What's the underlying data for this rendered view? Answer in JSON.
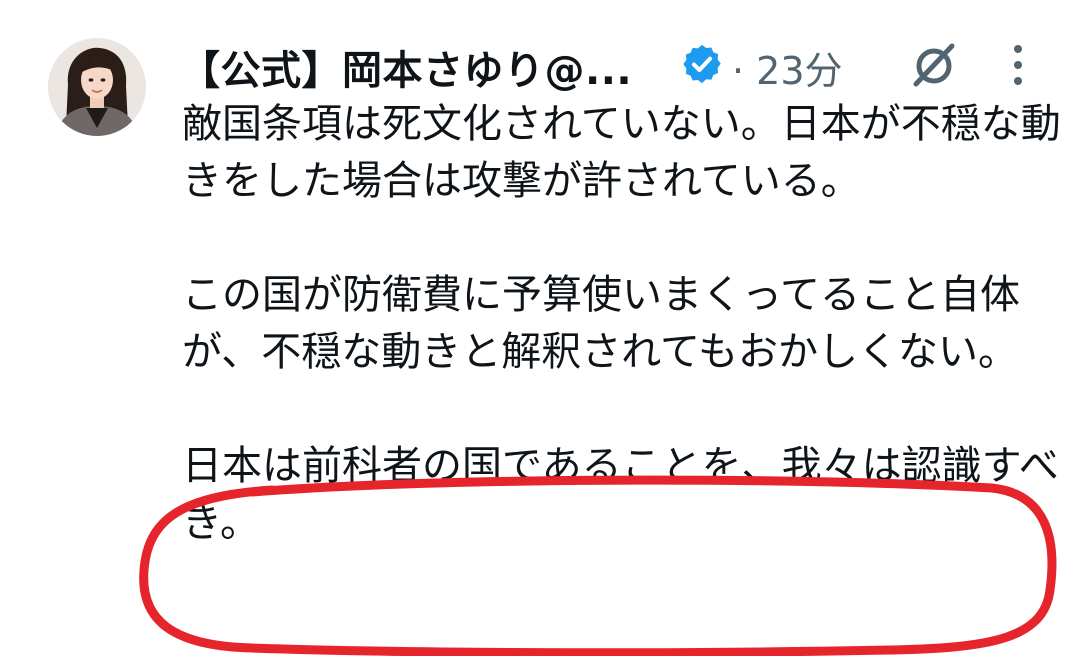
{
  "post": {
    "display_name": "【公式】岡本さゆり@...",
    "verified_icon": "verified-badge-icon",
    "timestamp": "· 23分",
    "grok_icon": "grok-icon",
    "more_icon": "more-vertical-icon",
    "paragraphs": [
      "敵国条項は死文化されていない。日本が不穏な動きをした場合は攻撃が許されている。",
      "この国が防衛費に予算使いまくってること自体が、不穏な動きと解釈されてもおかしくない。",
      "日本は前科者の国であることを、我々は認識すべき。"
    ]
  },
  "colors": {
    "verified_blue": "#1d9bf0",
    "secondary_text": "#536471",
    "highlight_red": "#e5242b"
  }
}
